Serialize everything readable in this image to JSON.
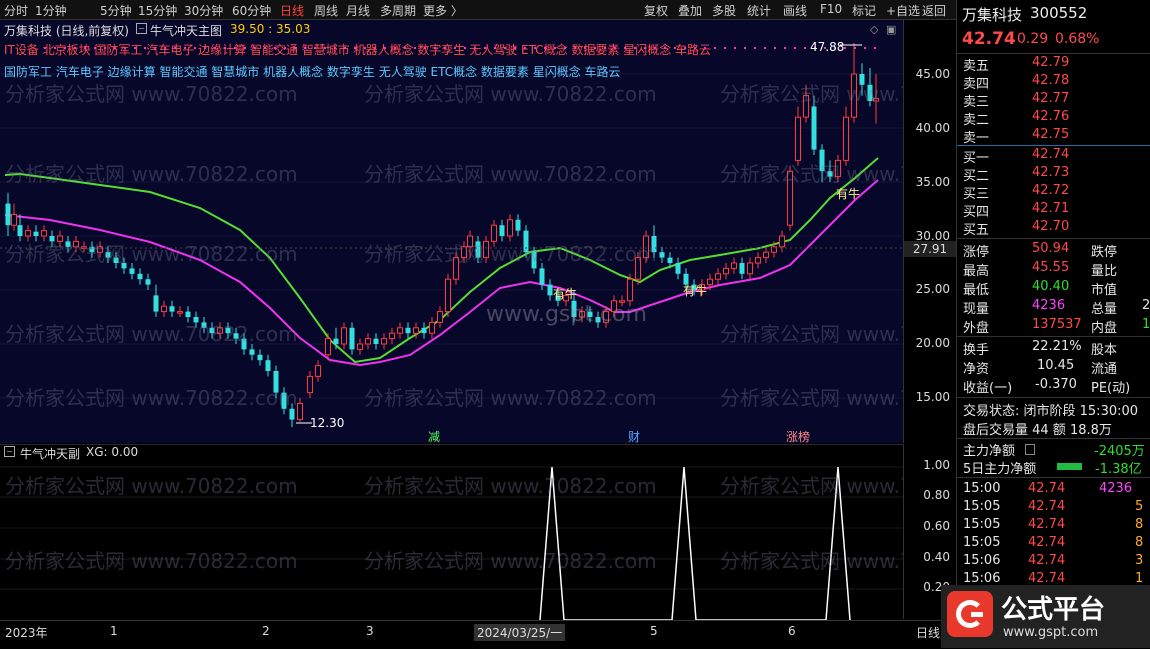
{
  "toolbar": {
    "left_items": [
      "分时",
      "1分钟",
      "5分钟",
      "15分钟",
      "30分钟",
      "60分钟",
      "日线",
      "周线",
      "月线",
      "多周期",
      "更多 〉"
    ],
    "active_index": 6,
    "right_items": [
      "复权",
      "叠加",
      "多股",
      "统计",
      "画线",
      "F10",
      "标记",
      "+自选",
      "返回"
    ]
  },
  "main": {
    "stock_title": "万集科技 (日线,前复权)",
    "indicator_name": "牛气冲天主图",
    "indicator_values": "39.50 : 35.03",
    "hot_line_1": "IT设备 北京板块 国防军工 汽车电子 边缘计算 智能交通 智慧城市 机器人概念 数字孪生 无人驾驶 ETC概念 数据要素 星闪概念 车路云",
    "hot_line_2": "国防军工 汽车电子 边缘计算 智能交通 智慧城市 机器人概念 数字孪生 无人驾驶 ETC概念 数据要素 星闪概念 车路云",
    "high_label": "47.88",
    "low_label": "12.30",
    "watermark_1": "分析家公式网 www.70822.com",
    "watermark_2": "www.gspt.com",
    "signal_labels": [
      "有牛",
      "有牛",
      "有牛"
    ],
    "event_markers": [
      "减",
      "财",
      "涨榜"
    ],
    "price_tag": "27.91",
    "y_ticks": [
      "45.00",
      "40.00",
      "35.00",
      "30.00",
      "25.00",
      "20.00",
      "15.00"
    ],
    "y_scale": {
      "min": 10,
      "max": 50
    }
  },
  "sub": {
    "indicator_title": "牛气冲天副",
    "indicator_xg": "XG: 0.00",
    "y_ticks": [
      "1.00",
      "0.80",
      "0.60",
      "0.40",
      "0.20"
    ]
  },
  "xaxis": {
    "labels": [
      "2023年",
      "1",
      "2",
      "3",
      "2024/03/25/一",
      "5",
      "6"
    ],
    "period": "日线"
  },
  "quote_panel": {
    "name": "万集科技",
    "code": "300552",
    "price": "42.74",
    "change": "0.29",
    "pct": "0.68%",
    "asks": [
      {
        "label": "卖五",
        "price": "42.79"
      },
      {
        "label": "卖四",
        "price": "42.78"
      },
      {
        "label": "卖三",
        "price": "42.77"
      },
      {
        "label": "卖二",
        "price": "42.76"
      },
      {
        "label": "卖一",
        "price": "42.75"
      }
    ],
    "bids": [
      {
        "label": "买一",
        "price": "42.74"
      },
      {
        "label": "买二",
        "price": "42.73"
      },
      {
        "label": "买三",
        "price": "42.72"
      },
      {
        "label": "买四",
        "price": "42.71"
      },
      {
        "label": "买五",
        "price": "42.70"
      }
    ],
    "stats": [
      {
        "l1": "涨停",
        "v1": "50.94",
        "l2": "跌停",
        "v2": ""
      },
      {
        "l1": "最高",
        "v1": "45.55",
        "l2": "量比",
        "v2": ""
      },
      {
        "l1": "最低",
        "v1": "40.40",
        "l2": "市值",
        "v2": ""
      },
      {
        "l1": "现量",
        "v1": "4236",
        "l2": "总量",
        "v2": "2"
      },
      {
        "l1": "外盘",
        "v1": "137537",
        "l2": "内盘",
        "v2": "1"
      }
    ],
    "stats2": [
      {
        "l1": "换手",
        "v1": "22.21%",
        "l2": "股本",
        "v2": ""
      },
      {
        "l1": "净资",
        "v1": "10.45",
        "l2": "流通",
        "v2": ""
      },
      {
        "l1": "收益(一)",
        "v1": "-0.370",
        "l2": "PE(动)",
        "v2": ""
      }
    ],
    "trade_status": "交易状态: 闭市阶段 15:30:00",
    "after_hours": "盘后交易量 44 额 18.8万",
    "main_net_label": "主力净额",
    "main_net_value": "-2405万",
    "main_net5_label": "5日主力净额",
    "main_net5_value": "-1.38亿",
    "ticks": [
      {
        "t": "15:00",
        "p": "42.74",
        "v": "4236"
      },
      {
        "t": "15:05",
        "p": "42.74",
        "v": "5"
      },
      {
        "t": "15:05",
        "p": "42.74",
        "v": "8"
      },
      {
        "t": "15:05",
        "p": "42.74",
        "v": "8"
      },
      {
        "t": "15:06",
        "p": "42.74",
        "v": "3"
      },
      {
        "t": "15:06",
        "p": "42.74",
        "v": "1"
      }
    ]
  },
  "logo": {
    "text": "公式平台",
    "url": "www.gspt.com"
  },
  "colors": {
    "up": "#ff3b3b",
    "down": "#33e0e0",
    "green_band": "#55dd33",
    "magenta_band": "#ee33ee",
    "bg": "#07072a"
  }
}
